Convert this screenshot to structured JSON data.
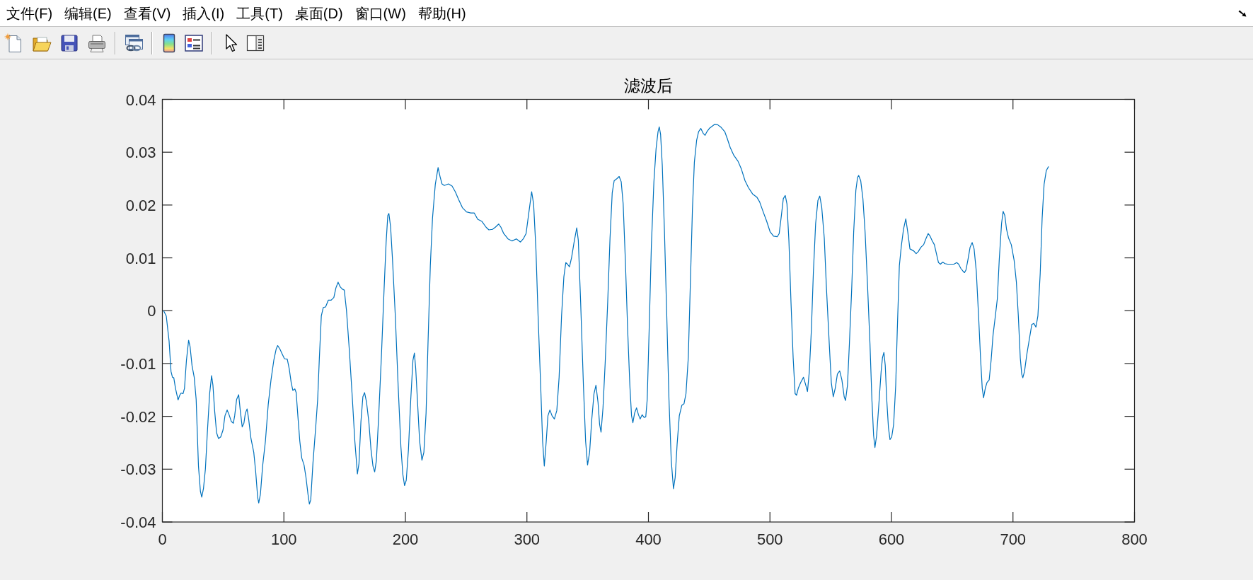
{
  "menu_bar": {
    "items": [
      "文件(F)",
      "编辑(E)",
      "查看(V)",
      "插入(I)",
      "工具(T)",
      "桌面(D)",
      "窗口(W)",
      "帮助(H)"
    ]
  },
  "figure": {
    "chart_data": {
      "type": "line",
      "title": "滤波后",
      "xlim": [
        0,
        800
      ],
      "ylim": [
        -0.04,
        0.04
      ],
      "xticks": [
        0,
        100,
        200,
        300,
        400,
        500,
        600,
        700,
        800
      ],
      "yticks": [
        -0.04,
        -0.03,
        -0.02,
        -0.01,
        0,
        0.01,
        0.02,
        0.03,
        0.04
      ],
      "x": [
        1,
        3.2,
        5.5,
        7.1,
        8.3,
        9.4,
        10.8,
        12.9,
        14.3,
        15.4,
        17,
        18.2,
        19.8,
        21.6,
        22.8,
        24.4,
        26.2,
        27.8,
        29.7,
        31.3,
        32.4,
        33.8,
        35.4,
        37,
        38.9,
        40.5,
        41.6,
        43,
        44.6,
        46.2,
        48,
        49.9,
        51.5,
        53.3,
        54.9,
        56.8,
        58.4,
        59.5,
        61.1,
        62.8,
        64.1,
        65.7,
        67.1,
        68.3,
        69.7,
        71,
        72.9,
        75.2,
        76.8,
        78.4,
        79.3,
        80.7,
        82.5,
        84.8,
        87.1,
        89.4,
        91.7,
        93.6,
        94.9,
        96.8,
        98.6,
        100.5,
        102.8,
        104.4,
        106,
        107.4,
        109,
        110.1,
        111.7,
        113.1,
        114.7,
        116.6,
        118.2,
        119.8,
        121,
        122.1,
        123.9,
        126.2,
        127.8,
        129.2,
        130.8,
        132.4,
        134.3,
        136.6,
        138.9,
        141.1,
        142.8,
        144.6,
        146.4,
        148,
        149.7,
        151.5,
        153.8,
        156.1,
        158.4,
        160.5,
        161.8,
        163.4,
        165,
        166.4,
        168,
        169.9,
        171.7,
        173.3,
        174.7,
        176.1,
        177.9,
        180.2,
        182.5,
        184.1,
        185.5,
        186.4,
        187.8,
        189.4,
        191.7,
        194,
        196.3,
        197.9,
        199.3,
        200.7,
        202.5,
        204.4,
        206.2,
        207.4,
        208.5,
        210.1,
        211.7,
        213.6,
        215.2,
        217,
        218.6,
        220.5,
        222.3,
        224.6,
        226.9,
        228.5,
        230.1,
        232,
        235.4,
        238.4,
        241.1,
        243.9,
        246.9,
        250.3,
        253.8,
        256.6,
        259.5,
        263,
        266.4,
        268.7,
        271.7,
        274,
        276.8,
        278.6,
        280.9,
        284.4,
        287.8,
        291.3,
        294.7,
        297,
        299.3,
        301.6,
        303.9,
        305.5,
        307.4,
        309.2,
        311.3,
        312.9,
        314.3,
        315.9,
        317.3,
        318.9,
        320.7,
        322.6,
        324.6,
        326.5,
        328.5,
        330.4,
        332,
        333.4,
        335,
        336.8,
        338.7,
        341,
        342.3,
        344.2,
        346.5,
        348.3,
        349.9,
        351.6,
        353.4,
        355.2,
        356.8,
        358.5,
        359.8,
        361,
        362.6,
        364.4,
        366.5,
        368.4,
        370.2,
        371.8,
        374.1,
        375.9,
        377.6,
        379.2,
        381,
        382.9,
        384.7,
        386.1,
        387.2,
        388.6,
        390.2,
        391.8,
        393.2,
        394.8,
        396.4,
        397.8,
        399,
        400.6,
        402.4,
        404.5,
        406.3,
        407.9,
        408.9,
        410,
        411.4,
        413.2,
        415.1,
        416.9,
        418.8,
        420.6,
        422,
        423.6,
        425.4,
        427.5,
        429.3,
        430.9,
        432.8,
        434.4,
        436.2,
        437.8,
        439.7,
        441.3,
        443.1,
        445,
        446.6,
        448.2,
        450.1,
        452.4,
        454.7,
        457,
        459.8,
        462.8,
        465,
        467.3,
        470.3,
        473.7,
        476.5,
        479.5,
        482.3,
        485.7,
        489.2,
        491.5,
        494.3,
        497.2,
        500.2,
        503,
        506,
        507.6,
        509.4,
        511,
        512.6,
        514,
        515.6,
        517.3,
        519.1,
        520.7,
        521.9,
        523.3,
        525.3,
        527.6,
        529.5,
        530.9,
        532.4,
        534.1,
        535.7,
        537.6,
        539.5,
        541,
        542.6,
        544.7,
        546.5,
        548.8,
        550.5,
        552.1,
        553.7,
        555.5,
        557.4,
        559.2,
        561.1,
        562.2,
        563.8,
        565.4,
        567.3,
        568.9,
        570.7,
        572.1,
        573,
        574.7,
        576.5,
        578.3,
        580.4,
        582.3,
        583.9,
        585.3,
        586.4,
        587.8,
        589.6,
        591.5,
        592.6,
        593.8,
        594.9,
        596.1,
        597.5,
        598.8,
        600.2,
        601.8,
        603.5,
        604.8,
        606.5,
        608.1,
        609.9,
        611.8,
        613.4,
        615.2,
        616.8,
        618.4,
        620.3,
        622.1,
        624.2,
        626.5,
        628.3,
        630.2,
        631.8,
        633.4,
        635.3,
        637.1,
        638.7,
        640.3,
        642.2,
        644,
        646.3,
        649.1,
        651.4,
        653.7,
        655.3,
        657.1,
        658.8,
        660.1,
        661.3,
        662.9,
        664.7,
        666.4,
        668,
        669.8,
        671.7,
        673.3,
        674.7,
        675.8,
        677.2,
        678.6,
        680.4,
        682,
        683.6,
        685.5,
        687.1,
        688.7,
        690.6,
        691.9,
        693.3,
        694.7,
        696.3,
        698.6,
        700.9,
        702.8,
        704.4,
        706,
        707.2,
        708.1,
        709.5,
        711.3,
        713.6,
        715.5,
        717.1,
        718.9,
        720.5,
        722.4,
        724,
        725.6,
        727.4,
        729.3
      ],
      "values": [
        0,
        -0.001,
        -0.0057,
        -0.0115,
        -0.0126,
        -0.0127,
        -0.0147,
        -0.0169,
        -0.016,
        -0.0156,
        -0.0157,
        -0.0147,
        -0.0094,
        -0.0056,
        -0.0068,
        -0.0104,
        -0.0126,
        -0.0168,
        -0.0294,
        -0.0342,
        -0.0353,
        -0.0337,
        -0.03,
        -0.0231,
        -0.0157,
        -0.0123,
        -0.0141,
        -0.0189,
        -0.0231,
        -0.0242,
        -0.0239,
        -0.0226,
        -0.0199,
        -0.0188,
        -0.0197,
        -0.021,
        -0.0213,
        -0.0199,
        -0.0168,
        -0.0159,
        -0.0189,
        -0.022,
        -0.0213,
        -0.0194,
        -0.0186,
        -0.0205,
        -0.0242,
        -0.0268,
        -0.0305,
        -0.0353,
        -0.0364,
        -0.0347,
        -0.0294,
        -0.0247,
        -0.0178,
        -0.0131,
        -0.0094,
        -0.0073,
        -0.0066,
        -0.0073,
        -0.0082,
        -0.0091,
        -0.0092,
        -0.011,
        -0.0136,
        -0.0151,
        -0.0148,
        -0.0155,
        -0.0205,
        -0.0247,
        -0.0279,
        -0.0292,
        -0.0316,
        -0.0347,
        -0.0366,
        -0.0358,
        -0.0289,
        -0.022,
        -0.0168,
        -0.0089,
        -0.001,
        0.0006,
        0.0007,
        0.002,
        0.002,
        0.0025,
        0.0043,
        0.0054,
        0.0045,
        0.0041,
        0.0039,
        0.0001,
        -0.0073,
        -0.0157,
        -0.0247,
        -0.0309,
        -0.0289,
        -0.021,
        -0.0163,
        -0.0155,
        -0.0173,
        -0.021,
        -0.0263,
        -0.0294,
        -0.0305,
        -0.0284,
        -0.0205,
        -0.0089,
        0.0043,
        0.0128,
        0.018,
        0.0184,
        0.0159,
        0.0096,
        -0.001,
        -0.0141,
        -0.0258,
        -0.031,
        -0.0331,
        -0.0321,
        -0.0263,
        -0.0168,
        -0.0094,
        -0.008,
        -0.011,
        -0.0178,
        -0.0247,
        -0.0283,
        -0.0268,
        -0.0194,
        -0.0062,
        0.0085,
        0.0175,
        0.0239,
        0.0271,
        0.0254,
        0.024,
        0.0237,
        0.024,
        0.0236,
        0.0225,
        0.021,
        0.0195,
        0.0187,
        0.0185,
        0.0185,
        0.0173,
        0.0169,
        0.0158,
        0.0153,
        0.0154,
        0.0158,
        0.0164,
        0.0158,
        0.0146,
        0.0136,
        0.0132,
        0.0136,
        0.013,
        0.0136,
        0.0146,
        0.0186,
        0.0225,
        0.0202,
        0.0117,
        -0.001,
        -0.0141,
        -0.0247,
        -0.0294,
        -0.0247,
        -0.0199,
        -0.0188,
        -0.0199,
        -0.0205,
        -0.0189,
        -0.0126,
        -0.001,
        0.0064,
        0.0091,
        0.0088,
        0.0083,
        0.0101,
        0.0128,
        0.0157,
        0.0133,
        0.0017,
        -0.0141,
        -0.0247,
        -0.0292,
        -0.0268,
        -0.0205,
        -0.0157,
        -0.0141,
        -0.0173,
        -0.0215,
        -0.023,
        -0.0184,
        -0.0099,
        0.0017,
        0.0138,
        0.0223,
        0.0246,
        0.025,
        0.0254,
        0.0244,
        0.0202,
        0.0096,
        -0.0036,
        -0.0141,
        -0.0199,
        -0.0212,
        -0.0194,
        -0.0184,
        -0.0197,
        -0.0205,
        -0.0197,
        -0.0202,
        -0.0201,
        -0.0168,
        -0.0036,
        0.0122,
        0.0244,
        0.0307,
        0.0339,
        0.0348,
        0.0334,
        0.0275,
        0.0149,
        -0.001,
        -0.0168,
        -0.0284,
        -0.0337,
        -0.0316,
        -0.0253,
        -0.0199,
        -0.0179,
        -0.0176,
        -0.0157,
        -0.0089,
        0.0043,
        0.0191,
        0.0281,
        0.0323,
        0.0339,
        0.0345,
        0.0336,
        0.0332,
        0.0339,
        0.0345,
        0.0349,
        0.0353,
        0.0352,
        0.0347,
        0.0339,
        0.0325,
        0.0309,
        0.0294,
        0.0283,
        0.0268,
        0.0246,
        0.0233,
        0.0221,
        0.0215,
        0.0206,
        0.0188,
        0.017,
        0.0149,
        0.0141,
        0.014,
        0.0146,
        0.018,
        0.0212,
        0.0218,
        0.0202,
        0.0133,
        0.0017,
        -0.0089,
        -0.0157,
        -0.016,
        -0.0147,
        -0.0136,
        -0.0126,
        -0.0141,
        -0.0153,
        -0.0115,
        -0.0036,
        0.007,
        0.0165,
        0.0209,
        0.0217,
        0.0196,
        0.0138,
        0.0043,
        -0.0062,
        -0.0136,
        -0.0163,
        -0.0147,
        -0.012,
        -0.0114,
        -0.0131,
        -0.0163,
        -0.017,
        -0.0141,
        -0.0062,
        0.0043,
        0.0149,
        0.0228,
        0.0252,
        0.0256,
        0.0246,
        0.0212,
        0.0149,
        0.0043,
        -0.0062,
        -0.0168,
        -0.0236,
        -0.0259,
        -0.0236,
        -0.0178,
        -0.0115,
        -0.0089,
        -0.0079,
        -0.0104,
        -0.0168,
        -0.0221,
        -0.0244,
        -0.0239,
        -0.0215,
        -0.0141,
        -0.0036,
        0.0085,
        0.0122,
        0.0154,
        0.0174,
        0.0149,
        0.0117,
        0.0115,
        0.0113,
        0.0108,
        0.0112,
        0.012,
        0.0125,
        0.0136,
        0.0146,
        0.0141,
        0.0133,
        0.0125,
        0.0107,
        0.0091,
        0.0088,
        0.0092,
        0.0089,
        0.0088,
        0.0088,
        0.0088,
        0.0091,
        0.0088,
        0.008,
        0.0075,
        0.0072,
        0.0077,
        0.0096,
        0.012,
        0.0129,
        0.0117,
        0.0075,
        -0.001,
        -0.0089,
        -0.0147,
        -0.0165,
        -0.0147,
        -0.0136,
        -0.0131,
        -0.0094,
        -0.0046,
        -0.001,
        0.0022,
        0.0096,
        0.0165,
        0.0188,
        0.018,
        0.0154,
        0.0138,
        0.0125,
        0.0096,
        0.0054,
        -0.001,
        -0.0089,
        -0.012,
        -0.0127,
        -0.0115,
        -0.0084,
        -0.0052,
        -0.0026,
        -0.0024,
        -0.0031,
        -0.001,
        0.007,
        0.0175,
        0.0239,
        0.0265,
        0.0273
      ]
    }
  }
}
